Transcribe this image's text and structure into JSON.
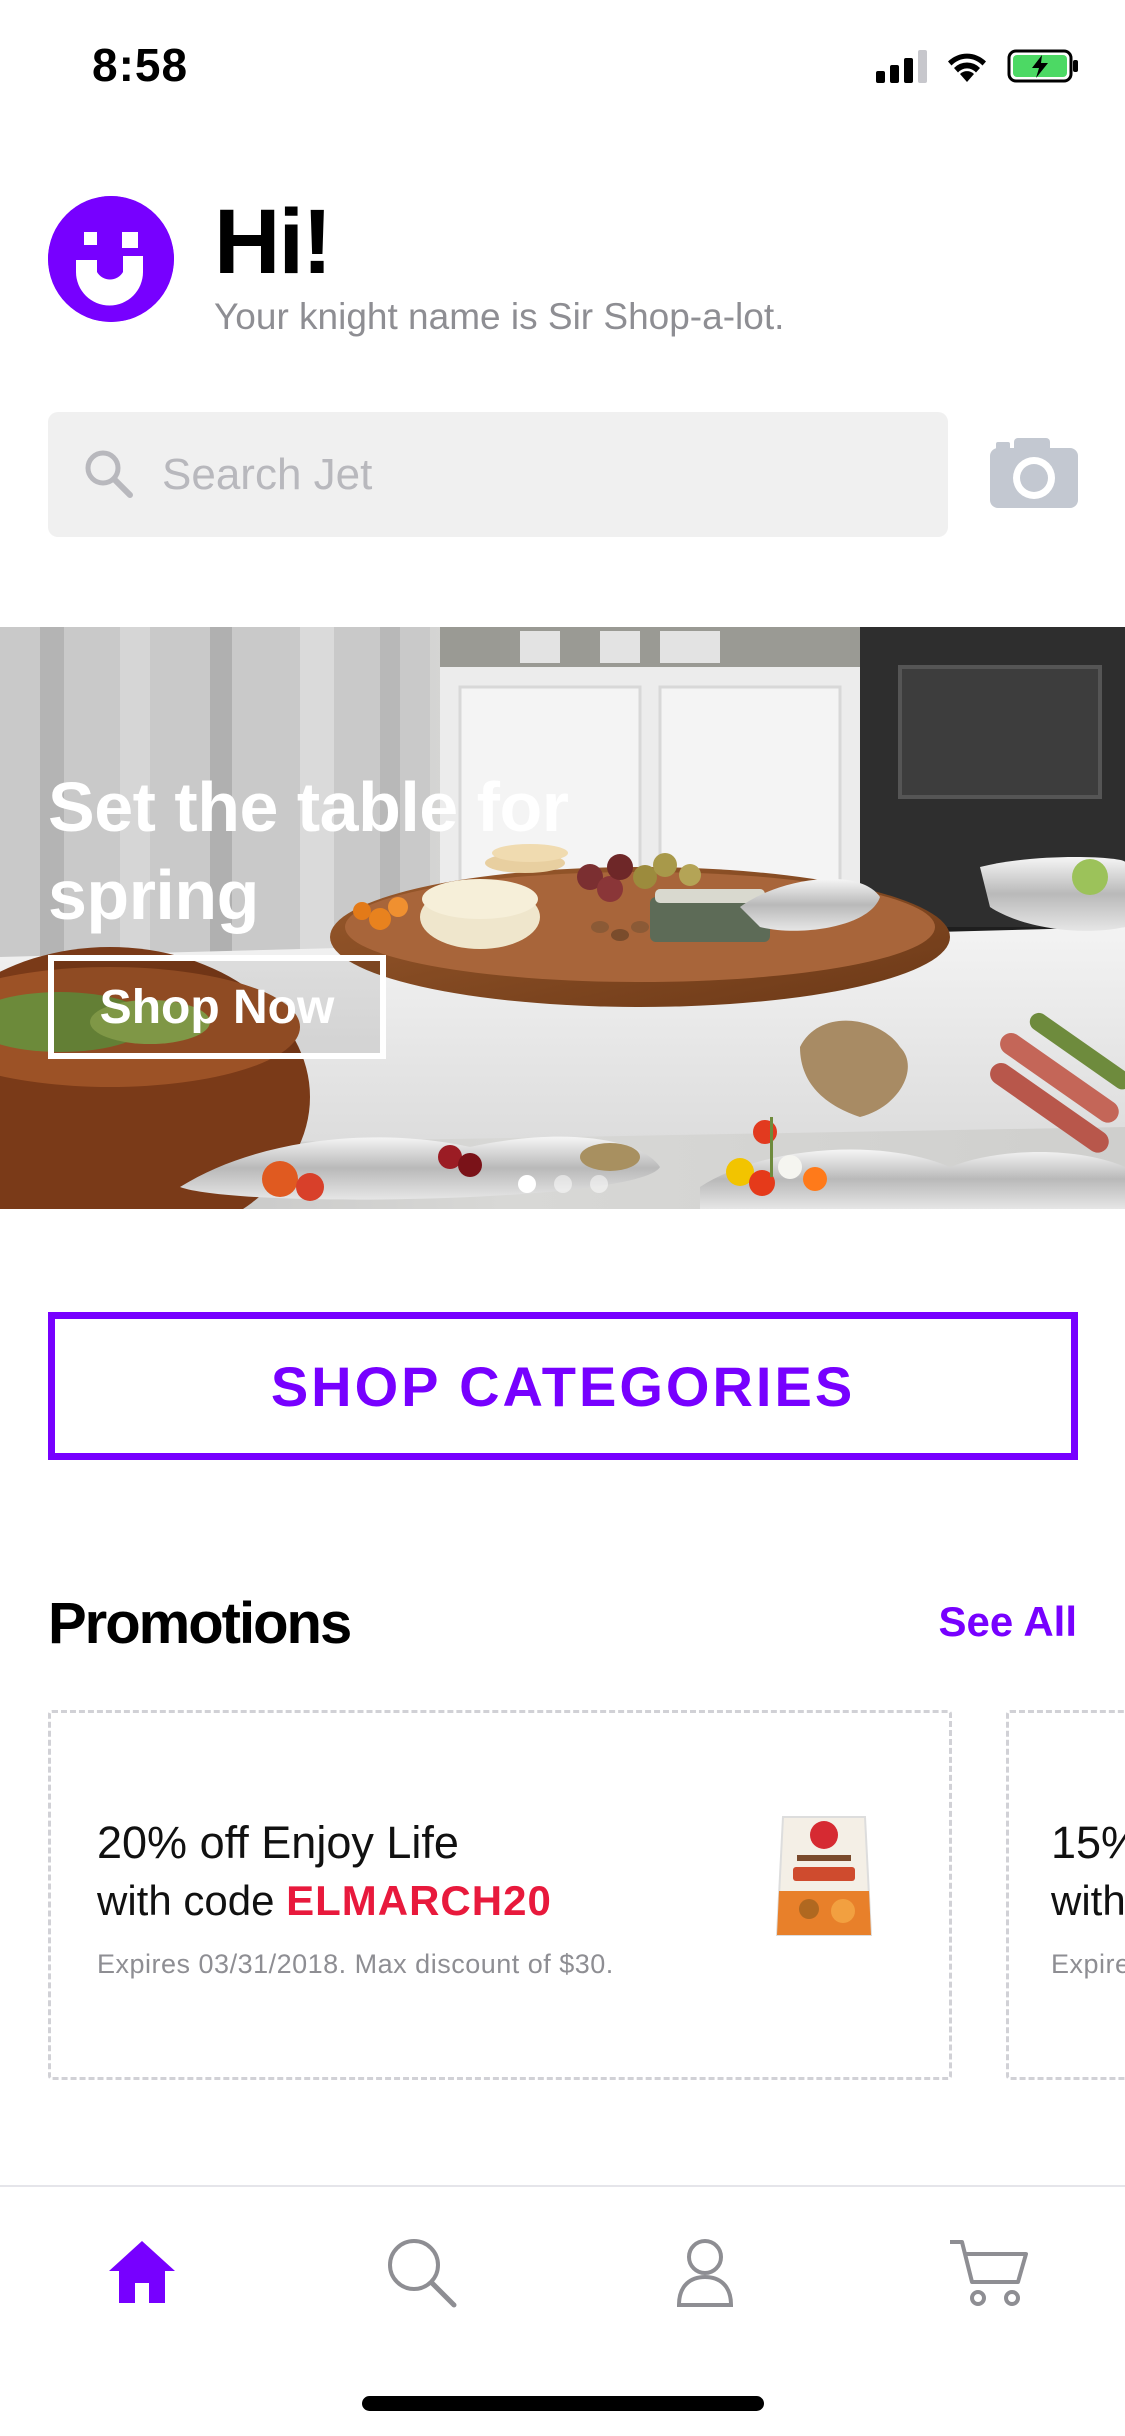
{
  "status_bar": {
    "time": "8:58",
    "signal_icon": "cellular-signal-icon",
    "wifi_icon": "wifi-icon",
    "battery_icon": "battery-charging-icon"
  },
  "header": {
    "logo_icon": "jet-smile-logo",
    "greeting": "Hi!",
    "subtitle": "Your knight name is Sir Shop-a-lot."
  },
  "search": {
    "placeholder": "Search Jet",
    "value": "",
    "icon": "search-icon",
    "camera_icon": "camera-icon"
  },
  "banner": {
    "title": "Set the table for spring",
    "button_label": "Shop Now",
    "slide_count": 3,
    "active_slide": 1
  },
  "shop_categories": {
    "label": "SHOP CATEGORIES"
  },
  "promotions": {
    "title": "Promotions",
    "see_all_label": "See All",
    "cards": [
      {
        "headline": "20% off Enjoy Life",
        "code_prefix": "with code ",
        "code": "ELMARCH20",
        "expiry": "Expires 03/31/2018. Max discount of $30."
      },
      {
        "headline": "15%",
        "code_prefix": "with",
        "code": "",
        "expiry": "Expire"
      }
    ]
  },
  "tab_bar": {
    "tabs": [
      {
        "icon": "home-icon",
        "active": true
      },
      {
        "icon": "search-icon",
        "active": false
      },
      {
        "icon": "account-icon",
        "active": false
      },
      {
        "icon": "cart-icon",
        "active": false
      }
    ]
  },
  "colors": {
    "brand": "#7700ff",
    "promo_code": "#e8193c",
    "muted_text": "#8e8e93",
    "search_bg": "#f0f0f0"
  }
}
